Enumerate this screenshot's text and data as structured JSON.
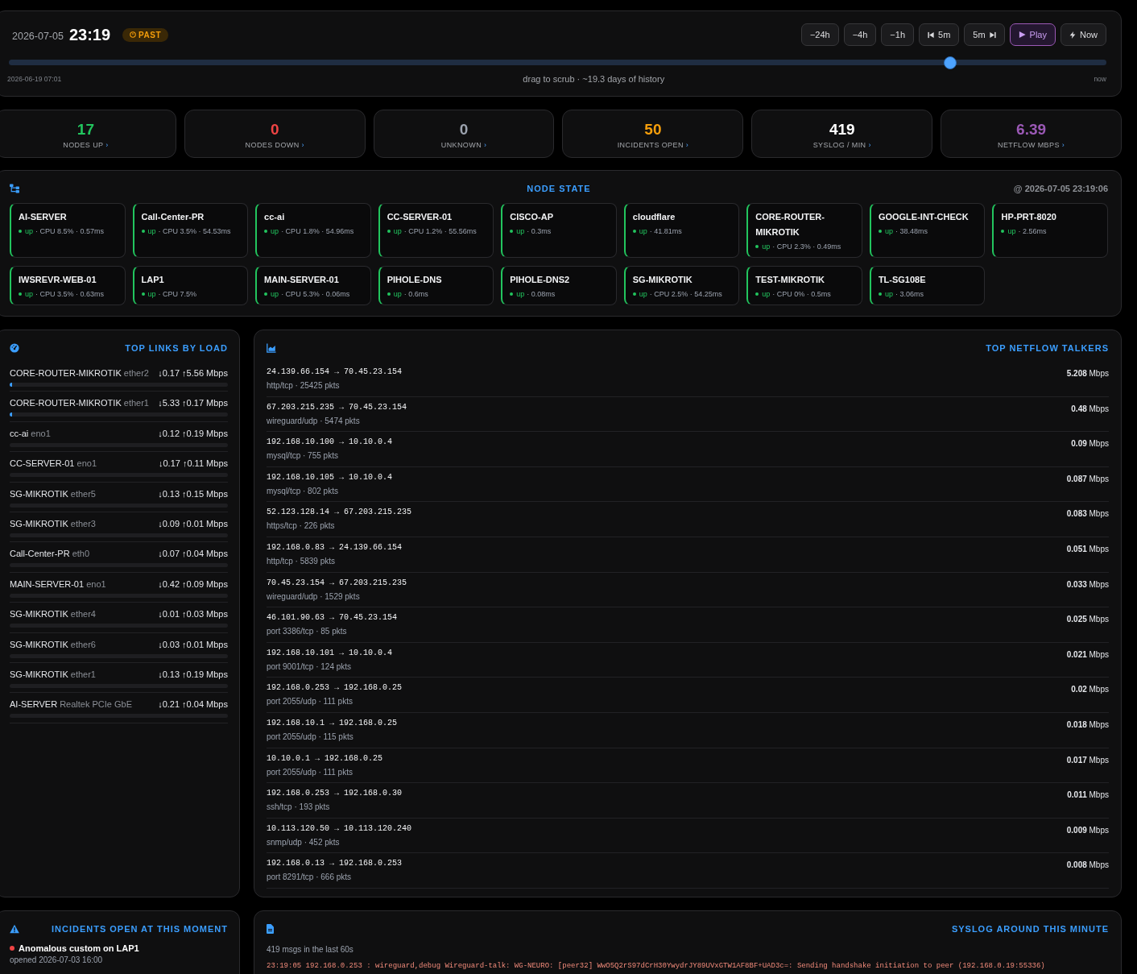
{
  "timeline": {
    "date": "2026-07-05",
    "time": "23:19",
    "mode": {
      "label": "PAST",
      "kind": "past"
    },
    "buttons": [
      {
        "label": "−24h",
        "kind": "jump",
        "highlighted": false
      },
      {
        "label": "−4h",
        "kind": "jump",
        "highlighted": false
      },
      {
        "label": "−1h",
        "kind": "jump",
        "highlighted": false
      },
      {
        "label": "5m",
        "kind": "step-back",
        "highlighted": false
      },
      {
        "label": "5m",
        "kind": "step-forward",
        "highlighted": false
      },
      {
        "label": "Play",
        "kind": "play",
        "highlighted": true
      },
      {
        "label": "Now",
        "kind": "now",
        "highlighted": false
      }
    ],
    "level": 0.858,
    "start_label": "2026-06-19 07:01",
    "hint": "drag to scrub · ~19.3 days of history",
    "end_label": "now"
  },
  "stats": [
    {
      "value": "17",
      "label": "NODES UP",
      "chevron": "›",
      "color": "#22c55e"
    },
    {
      "value": "0",
      "label": "NODES DOWN",
      "chevron": "›",
      "color": "#ef4444"
    },
    {
      "value": "0",
      "label": "UNKNOWN",
      "chevron": "›",
      "color": "#9ca3af"
    },
    {
      "value": "50",
      "label": "INCIDENTS OPEN",
      "chevron": "›",
      "color": "#f59e0b"
    },
    {
      "value": "419",
      "label": "SYSLOG / MIN",
      "chevron": "›",
      "color": "#ffffff"
    },
    {
      "value": "6.39",
      "label": "NETFLOW MBPS",
      "chevron": "›",
      "color": "#9b59b6"
    }
  ],
  "node_state": {
    "title": "NODE STATE",
    "timestamp": "@ 2026-07-05 23:19:06",
    "nodes": [
      {
        "name": "AI-SERVER",
        "status": "up",
        "detail": "· CPU 8.5% · 0.57ms"
      },
      {
        "name": "Call-Center-PR",
        "status": "up",
        "detail": "· CPU 3.5% · 54.53ms"
      },
      {
        "name": "cc-ai",
        "status": "up",
        "detail": "· CPU 1.8% · 54.96ms"
      },
      {
        "name": "CC-SERVER-01",
        "status": "up",
        "detail": "· CPU 1.2% · 55.56ms"
      },
      {
        "name": "CISCO-AP",
        "status": "up",
        "detail": "· 0.3ms"
      },
      {
        "name": "cloudflare",
        "status": "up",
        "detail": "· 41.81ms"
      },
      {
        "name": "CORE-ROUTER-MIKROTIK",
        "status": "up",
        "detail": "· CPU 2.3% · 0.49ms"
      },
      {
        "name": "GOOGLE-INT-CHECK",
        "status": "up",
        "detail": "· 38.48ms"
      },
      {
        "name": "HP-PRT-8020",
        "status": "up",
        "detail": "· 2.56ms"
      },
      {
        "name": "IWSREVR-WEB-01",
        "status": "up",
        "detail": "· CPU 3.5% · 0.63ms"
      },
      {
        "name": "LAP1",
        "status": "up",
        "detail": "· CPU 7.5%"
      },
      {
        "name": "MAIN-SERVER-01",
        "status": "up",
        "detail": "· CPU 5.3% · 0.06ms"
      },
      {
        "name": "PIHOLE-DNS",
        "status": "up",
        "detail": "· 0.6ms"
      },
      {
        "name": "PIHOLE-DNS2",
        "status": "up",
        "detail": "· 0.08ms"
      },
      {
        "name": "SG-MIKROTIK",
        "status": "up",
        "detail": "· CPU 2.5% · 54.25ms"
      },
      {
        "name": "TEST-MIKROTIK",
        "status": "up",
        "detail": "· CPU 0% · 0.5ms"
      },
      {
        "name": "TL-SG108E",
        "status": "up",
        "detail": "· 3.06ms"
      }
    ]
  },
  "top_links": {
    "title": "TOP LINKS BY LOAD",
    "rows": [
      {
        "device": "CORE-ROUTER-MIKROTIK",
        "iface": "ether2",
        "rate": "↓0.17 ↑5.56 Mbps",
        "level": 0.01
      },
      {
        "device": "CORE-ROUTER-MIKROTIK",
        "iface": "ether1",
        "rate": "↓5.33 ↑0.17 Mbps",
        "level": 0.01
      },
      {
        "device": "cc-ai",
        "iface": "eno1",
        "rate": "↓0.12 ↑0.19 Mbps"
      },
      {
        "device": "CC-SERVER-01",
        "iface": "eno1",
        "rate": "↓0.17 ↑0.11 Mbps"
      },
      {
        "device": "SG-MIKROTIK",
        "iface": "ether5",
        "rate": "↓0.13 ↑0.15 Mbps"
      },
      {
        "device": "SG-MIKROTIK",
        "iface": "ether3",
        "rate": "↓0.09 ↑0.01 Mbps"
      },
      {
        "device": "Call-Center-PR",
        "iface": "eth0",
        "rate": "↓0.07 ↑0.04 Mbps"
      },
      {
        "device": "MAIN-SERVER-01",
        "iface": "eno1",
        "rate": "↓0.42 ↑0.09 Mbps"
      },
      {
        "device": "SG-MIKROTIK",
        "iface": "ether4",
        "rate": "↓0.01 ↑0.03 Mbps"
      },
      {
        "device": "SG-MIKROTIK",
        "iface": "ether6",
        "rate": "↓0.03 ↑0.01 Mbps"
      },
      {
        "device": "SG-MIKROTIK",
        "iface": "ether1",
        "rate": "↓0.13 ↑0.19 Mbps"
      },
      {
        "device": "AI-SERVER",
        "iface": "Realtek PCIe GbE",
        "rate": "↓0.21 ↑0.04 Mbps"
      }
    ]
  },
  "netflow": {
    "title": "TOP NETFLOW TALKERS",
    "rows": [
      {
        "flow": "24.139.66.154 → 70.45.23.154",
        "meta": "http/tcp · 25425 pkts",
        "rate": "**5.208** Mbps"
      },
      {
        "flow": "67.203.215.235 → 70.45.23.154",
        "meta": "wireguard/udp · 5474 pkts",
        "rate": "**0.48** Mbps"
      },
      {
        "flow": "192.168.10.100 → 10.10.0.4",
        "meta": "mysql/tcp · 755 pkts",
        "rate": "**0.09** Mbps"
      },
      {
        "flow": "192.168.10.105 → 10.10.0.4",
        "meta": "mysql/tcp · 802 pkts",
        "rate": "**0.087** Mbps"
      },
      {
        "flow": "52.123.128.14 → 67.203.215.235",
        "meta": "https/tcp · 226 pkts",
        "rate": "**0.083** Mbps"
      },
      {
        "flow": "192.168.0.83 → 24.139.66.154",
        "meta": "http/tcp · 5839 pkts",
        "rate": "**0.051** Mbps"
      },
      {
        "flow": "70.45.23.154 → 67.203.215.235",
        "meta": "wireguard/udp · 1529 pkts",
        "rate": "**0.033** Mbps"
      },
      {
        "flow": "46.101.90.63 → 70.45.23.154",
        "meta": "port 3386/tcp · 85 pkts",
        "rate": "**0.025** Mbps"
      },
      {
        "flow": "192.168.10.101 → 10.10.0.4",
        "meta": "port 9001/tcp · 124 pkts",
        "rate": "**0.021** Mbps"
      },
      {
        "flow": "192.168.0.253 → 192.168.0.25",
        "meta": "port 2055/udp · 111 pkts",
        "rate": "**0.02** Mbps"
      },
      {
        "flow": "192.168.10.1 → 192.168.0.25",
        "meta": "port 2055/udp · 115 pkts",
        "rate": "**0.018** Mbps"
      },
      {
        "flow": "10.10.0.1 → 192.168.0.25",
        "meta": "port 2055/udp · 111 pkts",
        "rate": "**0.017** Mbps"
      },
      {
        "flow": "192.168.0.253 → 192.168.0.30",
        "meta": "ssh/tcp · 193 pkts",
        "rate": "**0.011** Mbps"
      },
      {
        "flow": "10.113.120.50 → 10.113.120.240",
        "meta": "snmp/udp · 452 pkts",
        "rate": "**0.009** Mbps"
      },
      {
        "flow": "192.168.0.13 → 192.168.0.253",
        "meta": "port 8291/tcp · 666 pkts",
        "rate": "**0.008** Mbps"
      }
    ]
  },
  "incidents": {
    "title": "INCIDENTS OPEN AT THIS MOMENT",
    "items": [
      {
        "title": "Anomalous custom on LAP1",
        "opened": "opened 2026-07-03 16:00",
        "color": "#ef4444"
      }
    ]
  },
  "syslog": {
    "title": "SYSLOG AROUND THIS MINUTE",
    "summary": "419 msgs in the last 60s",
    "lines": [
      "23:19:05 192.168.0.253 : wireguard,debug Wireguard-talk: WG-NEURO: [peer32] WwO5Q2rS97dCrH30YwydrJY89UVxGTW1AF8BF+UAD3c=: Sending handshake initiation to peer (192.168.0.19:55336)"
    ]
  }
}
